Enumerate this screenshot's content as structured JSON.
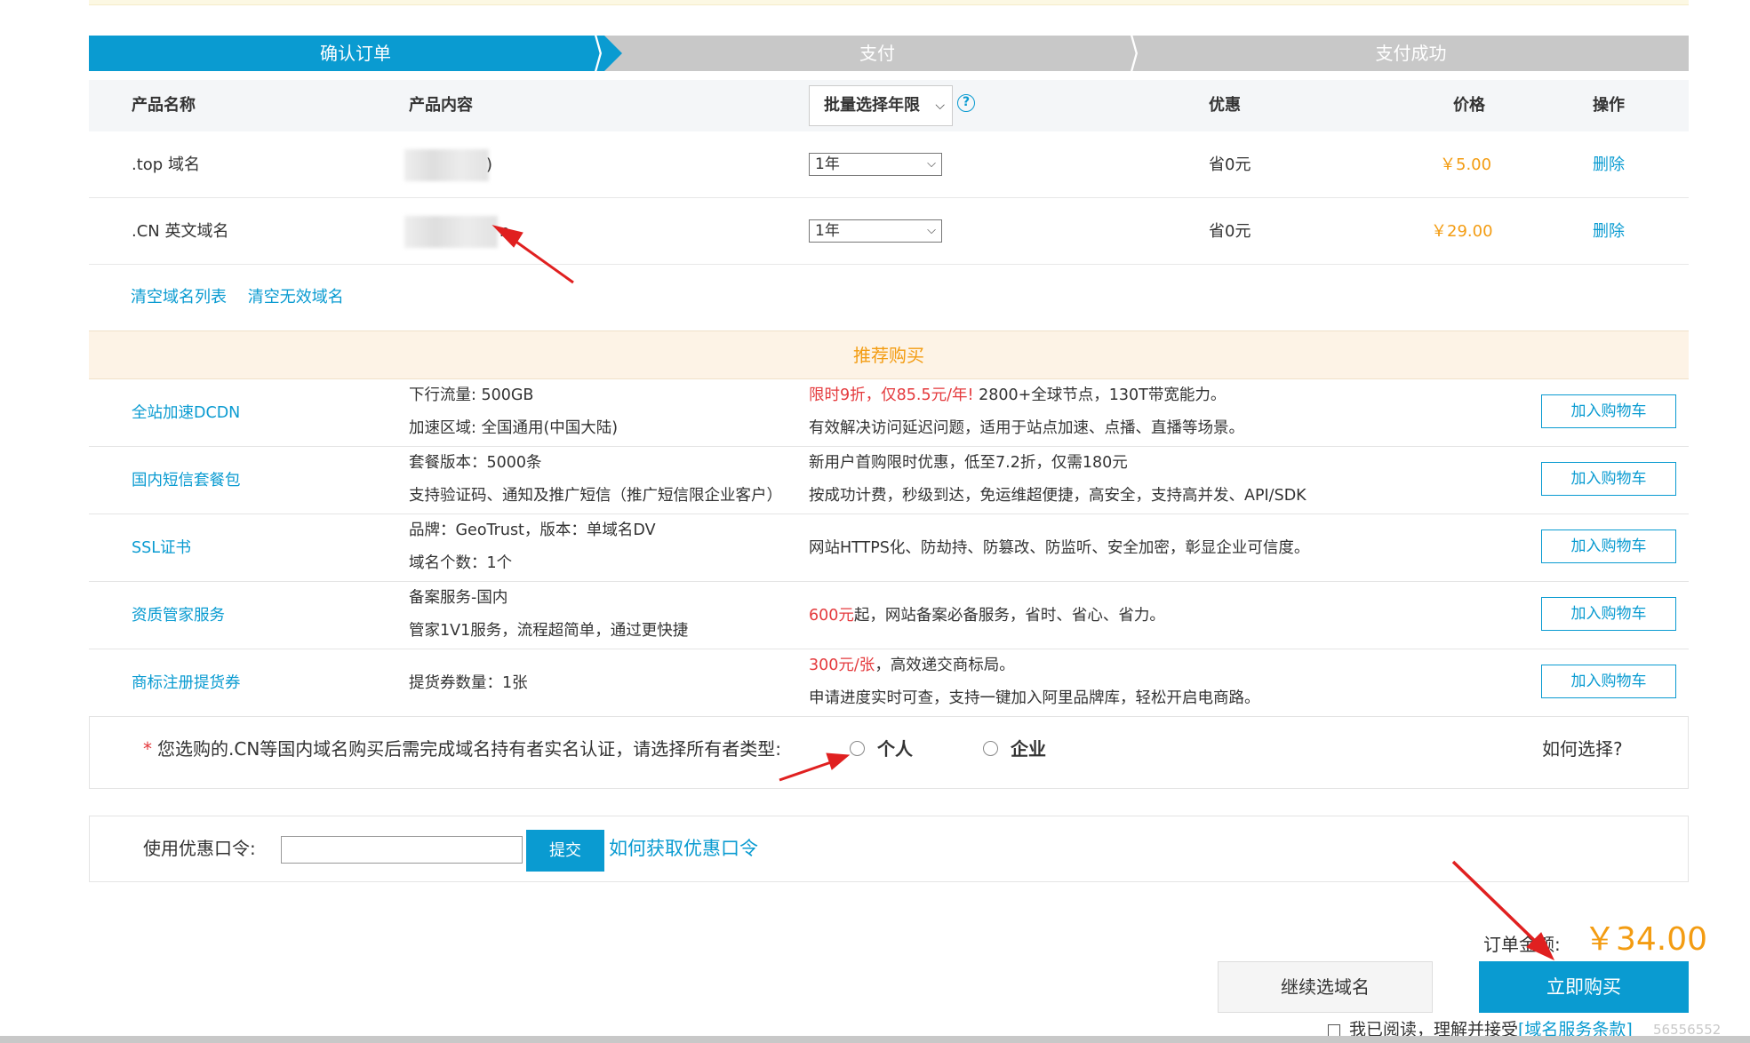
{
  "steps": [
    "确认订单",
    "支付",
    "支付成功"
  ],
  "table": {
    "headers": {
      "name": "产品名称",
      "content": "产品内容",
      "batch_select": "批量选择年限",
      "discount": "优惠",
      "price": "价格",
      "action": "操作"
    },
    "rows": [
      {
        "name": ".top 域名",
        "content_suffix": ")",
        "year": "1年",
        "discount": "省0元",
        "price": "￥5.00",
        "action": "删除"
      },
      {
        "name": ".CN 英文域名",
        "content_suffix": "n",
        "year": "1年",
        "discount": "省0元",
        "price": "￥29.00",
        "action": "删除"
      }
    ],
    "links": {
      "clear_list": "清空域名列表",
      "clear_invalid": "清空无效域名"
    }
  },
  "recommend": {
    "title": "推荐购买",
    "cart_label": "加入购物车",
    "items": [
      {
        "name": "全站加速DCDN",
        "spec": [
          "下行流量: 500GB",
          "加速区域: 全国通用(中国大陆)"
        ],
        "desc_red": "限时9折，仅85.5元/年!",
        "desc_rest": " 2800+全球节点，130T带宽能力。",
        "desc2": "有效解决访问延迟问题，适用于站点加速、点播、直播等场景。"
      },
      {
        "name": "国内短信套餐包",
        "spec": [
          "套餐版本：5000条",
          "支持验证码、通知及推广短信（推广短信限企业客户）"
        ],
        "desc_red": "",
        "desc_rest": "新用户首购限时优惠，低至7.2折，仅需180元",
        "desc2": "按成功计费，秒级到达，免运维超便捷，高安全，支持高并发、API/SDK"
      },
      {
        "name": "SSL证书",
        "spec": [
          "品牌：GeoTrust，版本：单域名DV",
          "域名个数：1个"
        ],
        "desc_red": "",
        "desc_rest": "网站HTTPS化、防劫持、防篡改、防监听、安全加密，彰显企业可信度。",
        "desc2": ""
      },
      {
        "name": "资质管家服务",
        "spec": [
          "备案服务-国内",
          "管家1V1服务，流程超简单，通过更快捷"
        ],
        "desc_red": "600元",
        "desc_rest": "起，网站备案必备服务，省时、省心、省力。",
        "desc2": ""
      },
      {
        "name": "商标注册提货券",
        "spec": [
          "提货券数量：1张"
        ],
        "desc_red": "300元/张",
        "desc_rest": "，高效递交商标局。",
        "desc2": "申请进度实时可查，支持一键加入阿里品牌库，轻松开启电商路。"
      }
    ]
  },
  "owner": {
    "notice": "您选购的.CN等国内域名购买后需完成域名持有者实名认证，请选择所有者类型:",
    "option_personal": "个人",
    "option_company": "企业",
    "how": "如何选择?"
  },
  "coupon": {
    "label": "使用优惠口令:",
    "value": "",
    "submit": "提交",
    "help": "如何获取优惠口令"
  },
  "footer": {
    "total_label": "订单金额:",
    "total": "￥34.00",
    "continue": "继续选域名",
    "buy": "立即购买",
    "agree_text": "我已阅读，理解并接受",
    "agree_link": "[域名服务条款]",
    "watermark": "56556552"
  },
  "colors": {
    "primary": "#0a9bd1",
    "price": "#f39c12",
    "promo_red": "#e4393c",
    "annotation_arrow": "#e02020"
  }
}
